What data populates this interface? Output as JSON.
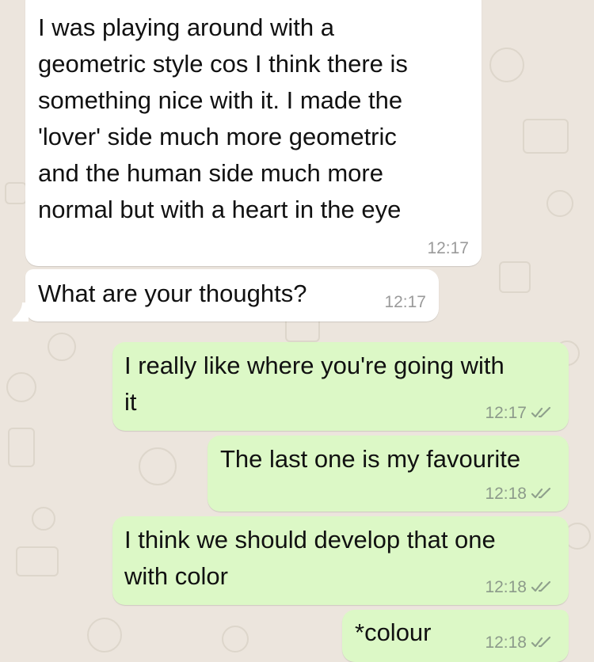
{
  "colors": {
    "chat_background": "#ece5dd",
    "incoming_bubble": "#ffffff",
    "outgoing_bubble": "#dcf8c6",
    "read_ticks": "#8fa08c"
  },
  "messages": [
    {
      "direction": "incoming",
      "text": "I was playing around with a\ngeometric style cos I think there is\nsomething nice with it. I made the\n'lover' side much more geometric\nand the human side much more\nnormal but with a heart in the eye",
      "time": "12:17"
    },
    {
      "direction": "incoming",
      "text": "What are your thoughts?",
      "time": "12:17"
    },
    {
      "direction": "outgoing",
      "text": "I really like where you're going with\nit",
      "time": "12:17",
      "status_icon": "double-check-icon"
    },
    {
      "direction": "outgoing",
      "text": "The last one is my favourite",
      "time": "12:18",
      "status_icon": "double-check-icon"
    },
    {
      "direction": "outgoing",
      "text": "I think we should develop that one\nwith color",
      "time": "12:18",
      "status_icon": "double-check-icon"
    },
    {
      "direction": "outgoing",
      "text": "*colour",
      "time": "12:18",
      "status_icon": "double-check-icon"
    }
  ]
}
